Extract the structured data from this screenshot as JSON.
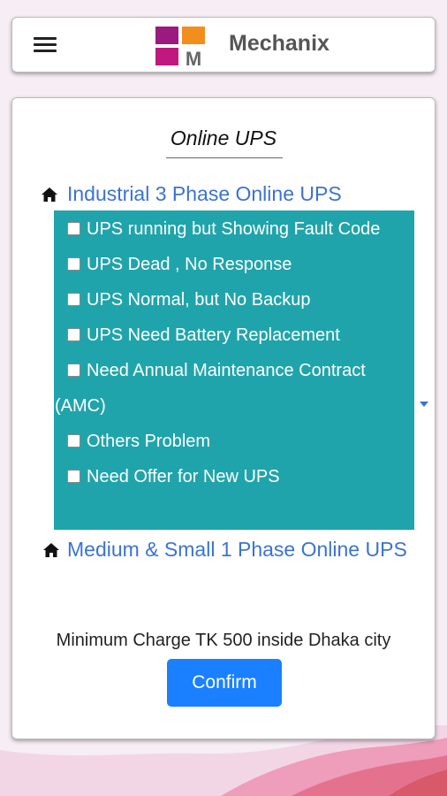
{
  "app": {
    "name": "Mechanix",
    "logo_letter": "M"
  },
  "colors": {
    "brand_purple": "#9b1a7e",
    "brand_orange": "#f28f1c",
    "panel_teal": "#20a4ab",
    "link_blue": "#3b73d4",
    "button_blue": "#1a80ff"
  },
  "page": {
    "title": "Online UPS"
  },
  "categories": [
    {
      "label": "Industrial 3 Phase Online UPS",
      "icon": "home-icon",
      "options": [
        {
          "label": "UPS running but Showing Fault Code",
          "checked": false
        },
        {
          "label": "UPS Dead , No Response",
          "checked": false
        },
        {
          "label": "UPS Normal, but No Backup",
          "checked": false
        },
        {
          "label": "UPS Need Battery Replacement",
          "checked": false
        },
        {
          "label": "Need Annual Maintenance Contract (AMC)",
          "checked": false
        },
        {
          "label": "Others Problem",
          "checked": false
        },
        {
          "label": "Need Offer for New UPS",
          "checked": false
        }
      ]
    },
    {
      "label": "Medium & Small 1 Phase Online UPS",
      "icon": "home-icon"
    }
  ],
  "note": "Minimum Charge TK 500 inside Dhaka city",
  "confirm_label": "Confirm"
}
